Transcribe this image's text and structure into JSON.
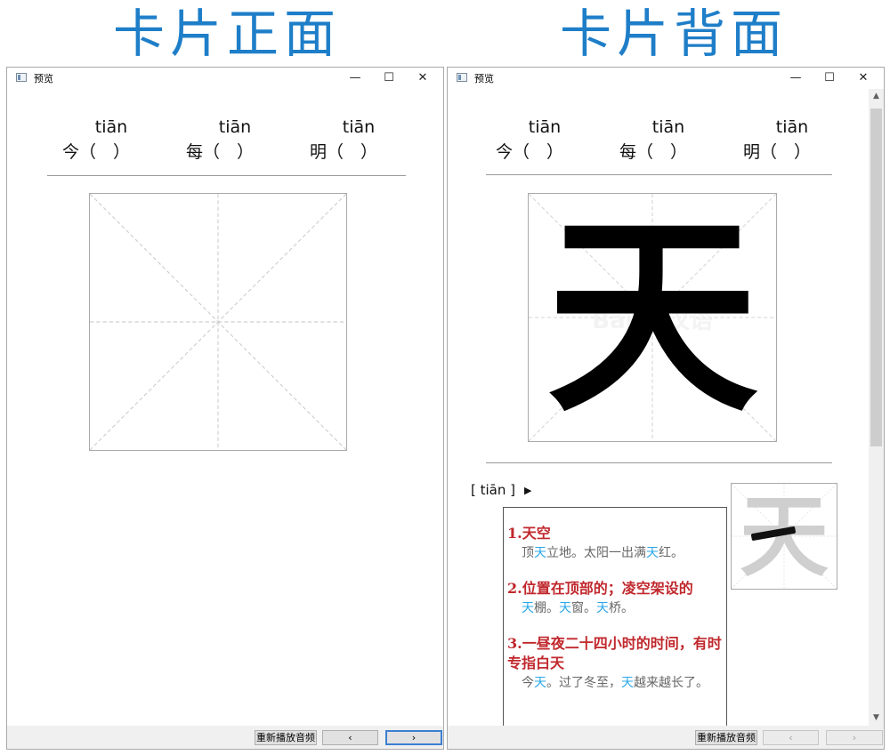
{
  "headings": {
    "front": "卡片正面",
    "back": "卡片背面"
  },
  "window": {
    "title": "预览",
    "controls": {
      "minimize": "—",
      "maximize": "☐",
      "close": "✕"
    }
  },
  "pinyin_row": [
    {
      "pinyin": "tiān",
      "word": "今（　）"
    },
    {
      "pinyin": "tiān",
      "word": "每（　）"
    },
    {
      "pinyin": "tiān",
      "word": "明（　）"
    }
  ],
  "character": "天",
  "watermark": "Baidu汉语",
  "pronunciation": {
    "label": "[ tiān ]",
    "play_icon": "▶"
  },
  "definitions": [
    {
      "head": "1.天空",
      "example_parts": [
        "顶",
        "天",
        "立地。太阳一出满",
        "天",
        "红。"
      ]
    },
    {
      "head": "2.位置在顶部的；凌空架设的",
      "example_parts": [
        "天",
        "棚。",
        "天",
        "窗。",
        "天",
        "桥。"
      ]
    },
    {
      "head": "3.一昼夜二十四小时的时间，有时专指白天",
      "example_parts": [
        "今",
        "天",
        "。过了冬至，",
        "天",
        "越来越长了。"
      ]
    }
  ],
  "buttons": {
    "replay": "重新播放音频",
    "prev": "‹",
    "next": "›"
  },
  "colors": {
    "heading": "#1e7ec8",
    "def_head": "#c0282d",
    "highlight": "#2aa7e8",
    "example": "#666666"
  }
}
